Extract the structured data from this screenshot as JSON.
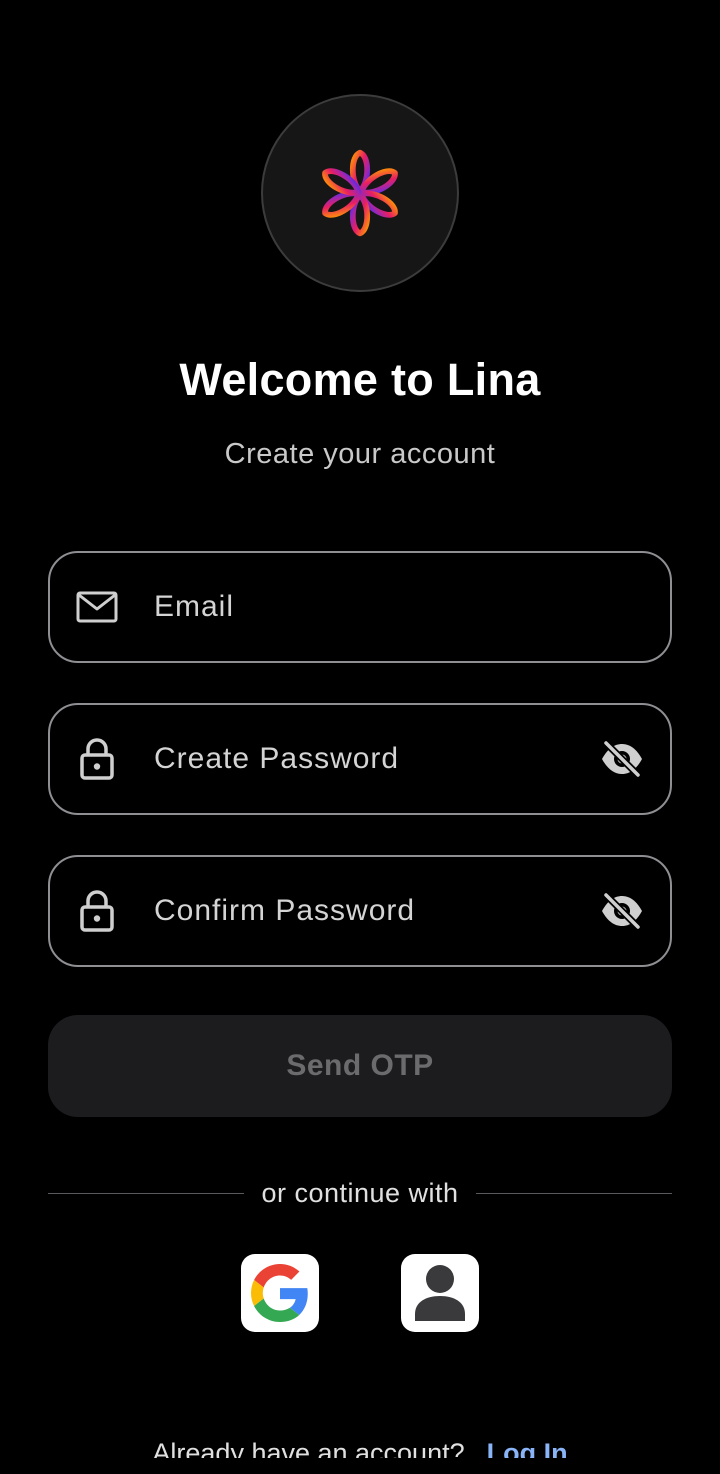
{
  "app": {
    "title": "Welcome to Lina",
    "subtitle": "Create your account",
    "logo": "lina-flower-logo"
  },
  "form": {
    "email": {
      "placeholder": "Email",
      "value": "",
      "icon": "mail-icon"
    },
    "create_password": {
      "placeholder": "Create Password",
      "value": "",
      "icon": "lock-icon",
      "toggle_icon": "eye-off-icon"
    },
    "confirm_password": {
      "placeholder": "Confirm Password",
      "value": "",
      "icon": "lock-icon",
      "toggle_icon": "eye-off-icon"
    },
    "submit_label": "Send OTP"
  },
  "social": {
    "divider_text": "or continue with",
    "providers": [
      {
        "name": "Google",
        "icon": "google-icon"
      },
      {
        "name": "Guest",
        "icon": "person-icon"
      }
    ]
  },
  "footer": {
    "prompt": "Already have an account?",
    "link_label": "Log In"
  },
  "colors": {
    "background": "#000000",
    "field_border": "#8e8e93",
    "button_bg": "#1c1c1e",
    "button_text": "#6b6b6e",
    "link": "#8ab4f8",
    "logo_gradient": [
      "#ff8a00",
      "#e91e63",
      "#7b1fa2",
      "#3d2bff"
    ]
  }
}
